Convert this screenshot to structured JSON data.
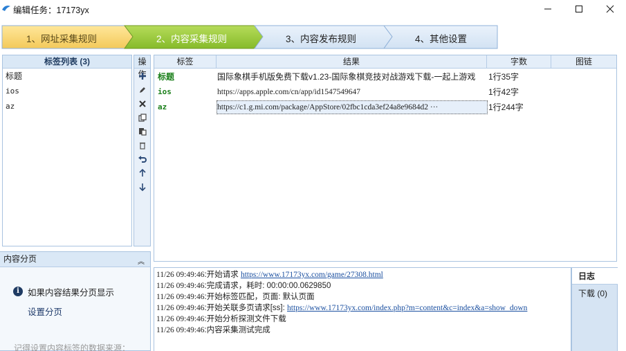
{
  "window": {
    "title": "编辑任务：17173yx"
  },
  "steps": [
    {
      "label": "1、网址采集规则",
      "state": "done"
    },
    {
      "label": "2、内容采集规则",
      "state": "active"
    },
    {
      "label": "3、内容发布规则",
      "state": "pending"
    },
    {
      "label": "4、其他设置",
      "state": "pending"
    }
  ],
  "tag_panel": {
    "title": "标签列表 (3)",
    "items": [
      "标题",
      "ios",
      "az"
    ]
  },
  "ops_panel": {
    "title": "操作",
    "icons": [
      "add-icon",
      "edit-icon",
      "delete-icon",
      "copy-icon",
      "paste-icon",
      "trash-icon",
      "undo-icon",
      "move-up-icon",
      "move-down-icon"
    ]
  },
  "results": {
    "columns": [
      "标签",
      "结果",
      "字数",
      "图链"
    ],
    "rows": [
      {
        "tag": "标题",
        "result": "国际象棋手机版免费下载v1.23-国际象棋竞技对战游戏下载-一起上游戏",
        "count": "1行35字"
      },
      {
        "tag": "ios",
        "result": "https://apps.apple.com/cn/app/id1547549647",
        "count": "1行42字"
      },
      {
        "tag": "az",
        "result": "https://c1.g.mi.com/package/AppStore/02fbc1cda3ef24a8e9684d2 ···",
        "count": "1行244字"
      }
    ]
  },
  "paging": {
    "title": "内容分页",
    "info": "如果内容结果分页显示",
    "link": "设置分页",
    "hint": "记得设置内容标签的数据来源："
  },
  "log": {
    "lines": [
      {
        "time": "11/26 09:49:46",
        "text": ":开始请求 ",
        "link": "https://www.17173yx.com/game/27308.html"
      },
      {
        "time": "11/26 09:49:46",
        "text": ":完成请求，耗时: 00:00:00.0629850",
        "link": ""
      },
      {
        "time": "11/26 09:49:46",
        "text": ":开始标签匹配，页面: 默认页面",
        "link": ""
      },
      {
        "time": "11/26 09:49:46",
        "text": ":开始关联多页请求[ss]: ",
        "link": "https://www.17173yx.com/index.php?m=content&c=index&a=show_down"
      },
      {
        "time": "11/26 09:49:46",
        "text": ":开始分析探测文件下载",
        "link": ""
      },
      {
        "time": "11/26 09:49:46",
        "text": ":内容采集测试完成",
        "link": ""
      }
    ]
  },
  "log_tabs": [
    {
      "label": "日志",
      "active": true
    },
    {
      "label": "下载 (0)",
      "active": false
    }
  ],
  "colors": {
    "step_done": "#dbe8f6",
    "step_active": "#93c437",
    "panel_header": "#dae8f6",
    "tag_green": "#1a7f1a",
    "link_blue": "#1a4fa0"
  }
}
